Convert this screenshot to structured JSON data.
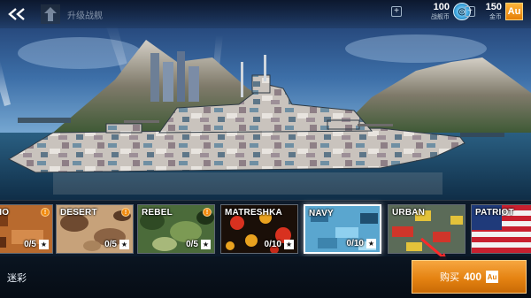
{
  "colors": {
    "accent_orange": "#e58312",
    "strip_bg": "#0e1a28",
    "sky_top": "#1e3a6a",
    "water": "#143a5a"
  },
  "header": {
    "back_icon": "double-chevron-left-icon",
    "upgrade_label": "升级战舰",
    "upgrade_icon": "arrow-up-icon",
    "currencies": [
      {
        "id": "credits",
        "value": "100",
        "label": "战舰币",
        "icon": "credits-coin-icon",
        "icon_text": ""
      },
      {
        "id": "gold",
        "value": "150",
        "label": "金币",
        "icon": "gold-au-icon",
        "icon_text": "Au"
      }
    ]
  },
  "camo_cards": [
    {
      "name": "CCHIO",
      "count": "0/5",
      "badge": "!"
    },
    {
      "name": "DESERT",
      "count": "0/5",
      "badge": "!"
    },
    {
      "name": "REBEL",
      "count": "0/5",
      "badge": "!"
    },
    {
      "name": "MATRESHKA",
      "count": "0/10",
      "badge": ""
    },
    {
      "name": "NAVY",
      "count": "0/10",
      "badge": ""
    },
    {
      "name": "URBAN",
      "count": "",
      "badge": ""
    },
    {
      "name": "PATRIOT",
      "count": "",
      "badge": ""
    }
  ],
  "star_glyph": "★",
  "section_label": "迷彩",
  "buy": {
    "label": "购买",
    "price": "400",
    "currency": "Au"
  }
}
